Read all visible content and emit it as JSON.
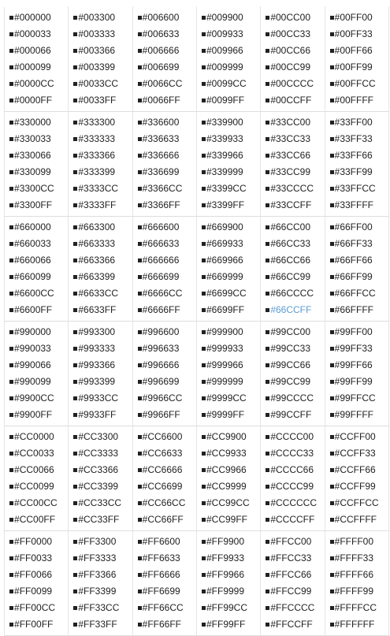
{
  "prefix": "#",
  "rows": [
    {
      "groups": [
        [
          "000000",
          "000033",
          "000066",
          "000099",
          "0000CC",
          "0000FF"
        ],
        [
          "003300",
          "003333",
          "003366",
          "003399",
          "0033CC",
          "0033FF"
        ],
        [
          "006600",
          "006633",
          "006666",
          "006699",
          "0066CC",
          "0066FF"
        ],
        [
          "009900",
          "009933",
          "009966",
          "009999",
          "0099CC",
          "0099FF"
        ],
        [
          "00CC00",
          "00CC33",
          "00CC66",
          "00CC99",
          "00CCCC",
          "00CCFF"
        ],
        [
          "00FF00",
          "00FF33",
          "00FF66",
          "00FF99",
          "00FFCC",
          "00FFFF"
        ]
      ]
    },
    {
      "groups": [
        [
          "330000",
          "330033",
          "330066",
          "330099",
          "3300CC",
          "3300FF"
        ],
        [
          "333300",
          "333333",
          "333366",
          "333399",
          "3333CC",
          "3333FF"
        ],
        [
          "336600",
          "336633",
          "336666",
          "336699",
          "3366CC",
          "3366FF"
        ],
        [
          "339900",
          "339933",
          "339966",
          "339999",
          "3399CC",
          "3399FF"
        ],
        [
          "33CC00",
          "33CC33",
          "33CC66",
          "33CC99",
          "33CCCC",
          "33CCFF"
        ],
        [
          "33FF00",
          "33FF33",
          "33FF66",
          "33FF99",
          "33FFCC",
          "33FFFF"
        ]
      ]
    },
    {
      "groups": [
        [
          "660000",
          "660033",
          "660066",
          "660099",
          "6600CC",
          "6600FF"
        ],
        [
          "663300",
          "663333",
          "663366",
          "663399",
          "6633CC",
          "6633FF"
        ],
        [
          "666600",
          "666633",
          "666666",
          "666699",
          "6666CC",
          "6666FF"
        ],
        [
          "669900",
          "669933",
          "669966",
          "669999",
          "6699CC",
          "6699FF"
        ],
        [
          "66CC00",
          "66CC33",
          "66CC66",
          "66CC99",
          "66CCCC",
          "66CCFF"
        ],
        [
          "66FF00",
          "66FF33",
          "66FF66",
          "66FF99",
          "66FFCC",
          "66FFFF"
        ]
      ]
    },
    {
      "groups": [
        [
          "990000",
          "990033",
          "990066",
          "990099",
          "9900CC",
          "9900FF"
        ],
        [
          "993300",
          "993333",
          "993366",
          "993399",
          "9933CC",
          "9933FF"
        ],
        [
          "996600",
          "996633",
          "996666",
          "996699",
          "9966CC",
          "9966FF"
        ],
        [
          "999900",
          "999933",
          "999966",
          "999999",
          "9999CC",
          "9999FF"
        ],
        [
          "99CC00",
          "99CC33",
          "99CC66",
          "99CC99",
          "99CCCC",
          "99CCFF"
        ],
        [
          "99FF00",
          "99FF33",
          "99FF66",
          "99FF99",
          "99FFCC",
          "99FFFF"
        ]
      ]
    },
    {
      "groups": [
        [
          "CC0000",
          "CC0033",
          "CC0066",
          "CC0099",
          "CC00CC",
          "CC00FF"
        ],
        [
          "CC3300",
          "CC3333",
          "CC3366",
          "CC3399",
          "CC33CC",
          "CC33FF"
        ],
        [
          "CC6600",
          "CC6633",
          "CC6666",
          "CC6699",
          "CC66CC",
          "CC66FF"
        ],
        [
          "CC9900",
          "CC9933",
          "CC9966",
          "CC9999",
          "CC99CC",
          "CC99FF"
        ],
        [
          "CCCC00",
          "CCCC33",
          "CCCC66",
          "CCCC99",
          "CCCCCC",
          "CCCCFF"
        ],
        [
          "CCFF00",
          "CCFF33",
          "CCFF66",
          "CCFF99",
          "CCFFCC",
          "CCFFFF"
        ]
      ]
    },
    {
      "groups": [
        [
          "FF0000",
          "FF0033",
          "FF0066",
          "FF0099",
          "FF00CC",
          "FF00FF"
        ],
        [
          "FF3300",
          "FF3333",
          "FF3366",
          "FF3399",
          "FF33CC",
          "FF33FF"
        ],
        [
          "FF6600",
          "FF6633",
          "FF6666",
          "FF6699",
          "FF66CC",
          "FF66FF"
        ],
        [
          "FF9900",
          "FF9933",
          "FF9966",
          "FF9999",
          "FF99CC",
          "FF99FF"
        ],
        [
          "FFCC00",
          "FFCC33",
          "FFCC66",
          "FFCC99",
          "FFCCCC",
          "FFCCFF"
        ],
        [
          "FFFF00",
          "FFFF33",
          "FFFF66",
          "FFFF99",
          "FFFFCC",
          "FFFFFF"
        ]
      ]
    }
  ],
  "highlight": {
    "code": "66CCFF",
    "color": "#5b9bd5"
  },
  "colors": {
    "text": "#222222",
    "swatch": "#222222",
    "grid": "#e6e6e6"
  },
  "icons": {
    "swatch": "square-bullet-icon"
  }
}
